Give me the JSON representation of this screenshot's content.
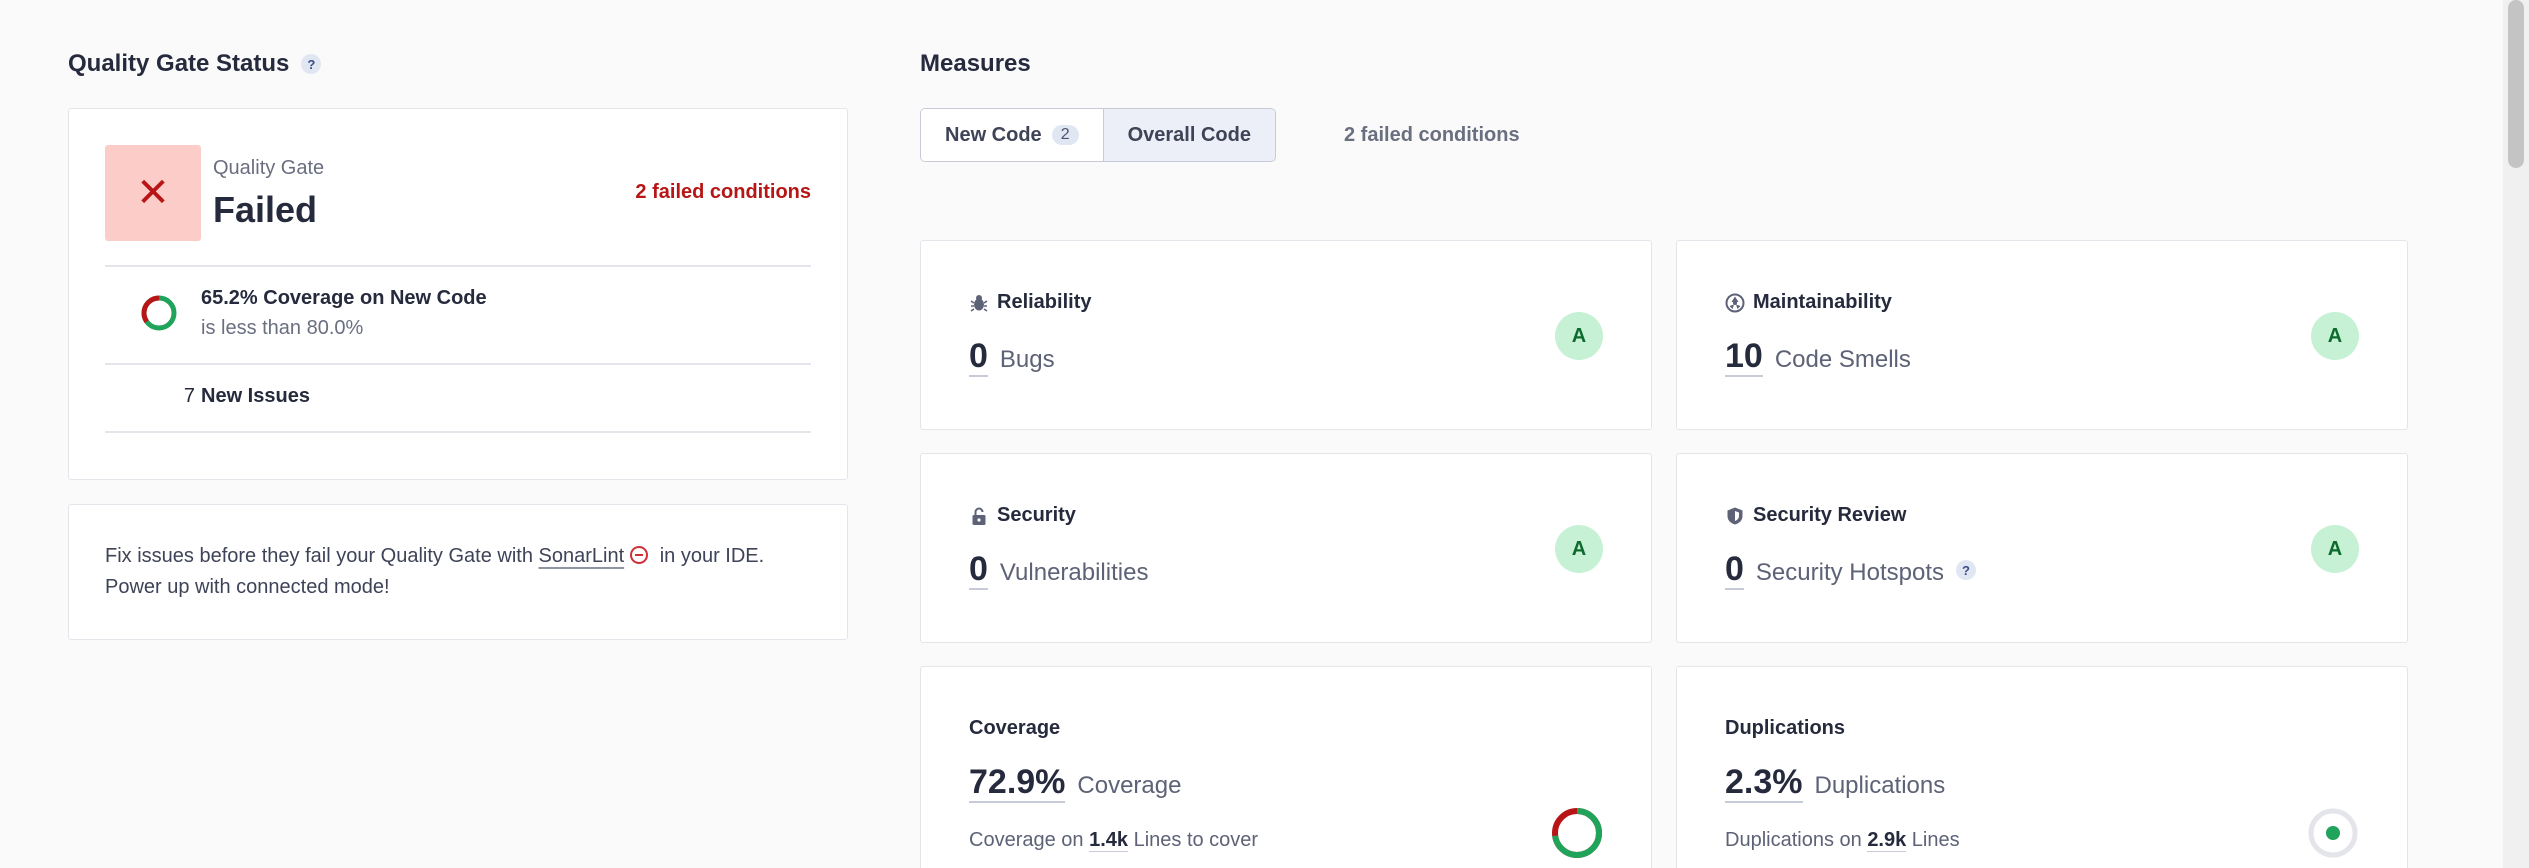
{
  "quality_gate": {
    "section_title": "Quality Gate Status",
    "help": "?",
    "label": "Quality Gate",
    "status": "Failed",
    "status_icon": "✕",
    "failed_conditions": "2 failed conditions",
    "condition": {
      "title": "65.2% Coverage on New Code",
      "subtitle": "is less than 80.0%",
      "coverage_fraction": 0.652
    },
    "new_issues": {
      "count": "7",
      "label": "New Issues"
    }
  },
  "promo": {
    "before": "Fix issues before they fail your Quality Gate with ",
    "link": "SonarLint",
    "after": " in your IDE. Power up with connected mode!"
  },
  "measures": {
    "section_title": "Measures",
    "tabs": [
      {
        "label": "New Code",
        "count": "2"
      },
      {
        "label": "Overall Code"
      }
    ],
    "failed_conditions": "2 failed conditions",
    "reliability": {
      "title": "Reliability",
      "value": "0",
      "unit": "Bugs",
      "rating": "A"
    },
    "maintainability": {
      "title": "Maintainability",
      "value": "10",
      "unit": "Code Smells",
      "rating": "A"
    },
    "security": {
      "title": "Security",
      "value": "0",
      "unit": "Vulnerabilities",
      "rating": "A"
    },
    "security_review": {
      "title": "Security Review",
      "value": "0",
      "unit": "Security Hotspots",
      "help": "?",
      "rating": "A"
    },
    "coverage": {
      "title": "Coverage",
      "value": "72.9%",
      "unit": "Coverage",
      "sub_prefix": "Coverage on ",
      "sub_value": "1.4k",
      "sub_suffix": " Lines to cover",
      "fraction": 0.729
    },
    "duplications": {
      "title": "Duplications",
      "value": "2.3%",
      "unit": "Duplications",
      "sub_prefix": "Duplications on ",
      "sub_value": "2.9k",
      "sub_suffix": " Lines"
    }
  },
  "colors": {
    "fail": "#b81616",
    "pass": "#20a35a",
    "rating_bg": "#c6f1d4"
  }
}
